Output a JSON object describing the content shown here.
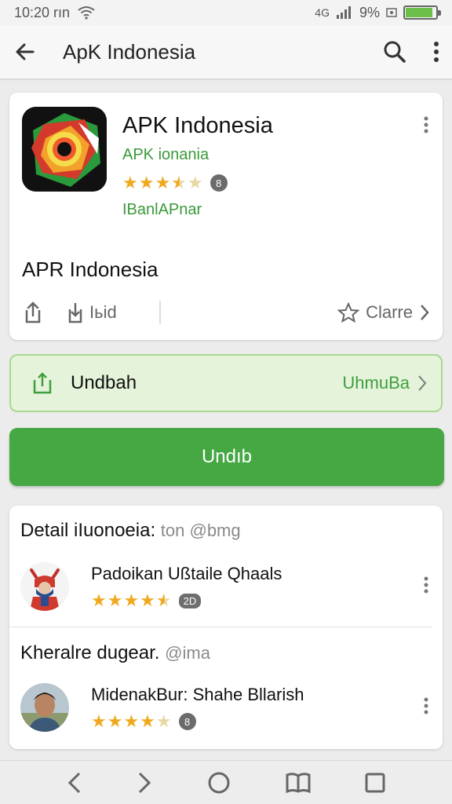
{
  "status": {
    "time": "10:20 rın",
    "signal_text": "4G",
    "battery_text": "9%",
    "battery_level": 0.9
  },
  "app_bar": {
    "title": "ApK Indonesia"
  },
  "app": {
    "name": "APK Indonesia",
    "developer": "APK ionania",
    "rating_stars": 3.5,
    "rating_badge": "8",
    "category": "IBanlAPnar",
    "subtitle": "APR Indonesia",
    "action_left_label": "Iьid",
    "action_right_label": "Clarre"
  },
  "install": {
    "label": "Undbah",
    "action_label": "UhmuBa"
  },
  "download": {
    "label": "Undıb"
  },
  "details": {
    "section1": {
      "title": "Detail iIuonoeia:",
      "tag": "ton @bmg"
    },
    "item1": {
      "name": "Padoikan Ußtaile Qhaals",
      "rating_stars": 4.5,
      "badge": "2D"
    },
    "section2": {
      "title": "Kheralre dugear.",
      "tag": "@ima"
    },
    "item2": {
      "name": "MidenakBur: Shahe Bllarish",
      "rating_stars": 4,
      "badge": "8"
    }
  },
  "colors": {
    "accent_green": "#45a843",
    "install_bg": "#e4f3da",
    "star": "#f0a91e"
  },
  "icons": [
    "back-icon",
    "search-icon",
    "more-vert-icon",
    "share-icon",
    "download-icon",
    "star-outline-icon",
    "chevron-right-icon",
    "install-icon",
    "nav-back-icon",
    "nav-forward-icon",
    "nav-home-icon",
    "nav-book-icon",
    "nav-recents-icon"
  ]
}
